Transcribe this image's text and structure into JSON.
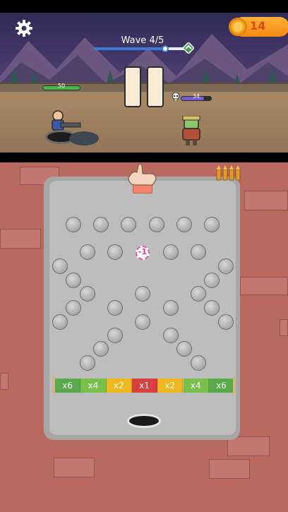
{
  "hud": {
    "coins": "14",
    "wave_label": "Wave 4/5",
    "wave_progress": 0.75
  },
  "player": {
    "hp": "50",
    "hp_fraction": 1.0
  },
  "enemy": {
    "hp": "34",
    "hp_fraction": 0.75
  },
  "board": {
    "ball_label": "-1",
    "multipliers": [
      {
        "label": "x6",
        "color": "#58a84a"
      },
      {
        "label": "x4",
        "color": "#78c04a"
      },
      {
        "label": "x2",
        "color": "#f0b81e"
      },
      {
        "label": "x1",
        "color": "#d84040"
      },
      {
        "label": "x2",
        "color": "#f0b81e"
      },
      {
        "label": "x4",
        "color": "#78c04a"
      },
      {
        "label": "x6",
        "color": "#58a84a"
      }
    ]
  },
  "icons": {
    "settings": "gear-icon",
    "coin": "coin-icon",
    "wave_end": "goal-chevron-icon",
    "skull": "skull-icon",
    "hand": "hand-icon",
    "ammo": "bullets-icon"
  },
  "colors": {
    "wall": "#b86a60",
    "plate": "#bdbdbd",
    "wave_fill": "#3c7ad6",
    "coin": "#f6a622"
  }
}
